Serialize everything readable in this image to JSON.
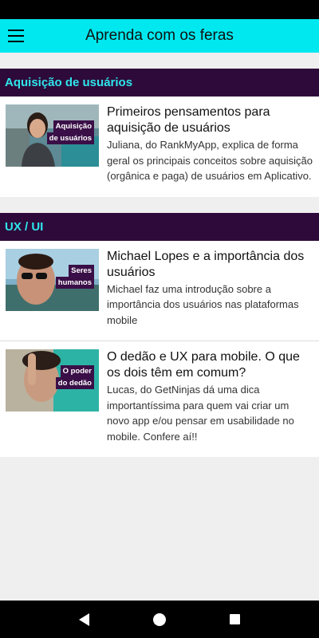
{
  "app_bar": {
    "title": "Aprenda com os feras",
    "menu_icon": "hamburger-menu-icon",
    "background": "#00e8ef"
  },
  "sections": [
    {
      "title": "Aquisição de usuários",
      "items": [
        {
          "thumb_caption_1": "Aquisição",
          "thumb_caption_2": "de usuários",
          "title": "Primeiros pensamentos para aquisição de usuários",
          "description": "Juliana, do RankMyApp, explica de forma geral os principais conceitos sobre aquisição (orgânica e paga) de usuários em Aplicativo."
        }
      ]
    },
    {
      "title": "UX / UI",
      "items": [
        {
          "thumb_caption_1": "Seres",
          "thumb_caption_2": "humanos",
          "title": "Michael Lopes e a importância dos usuários",
          "description": "Michael faz uma introdução sobre a importância dos usuários nas plataformas mobile"
        },
        {
          "thumb_caption_1": "O poder",
          "thumb_caption_2": "do dedão",
          "title": "O dedão e UX para mobile. O que os dois têm em comum?",
          "description": "Lucas, do GetNinjas dá uma dica importantíssima para quem vai criar um novo app e/ou pensar em usabilidade no mobile. Confere aí!!"
        }
      ]
    }
  ],
  "nav_bar": {
    "back_icon": "back-triangle-icon",
    "home_icon": "home-circle-icon",
    "recents_icon": "recents-square-icon"
  },
  "colors": {
    "section_header_bg": "#2e0a3a",
    "section_header_text": "#2ee6ec",
    "caption_bg": "#3a0f47"
  }
}
